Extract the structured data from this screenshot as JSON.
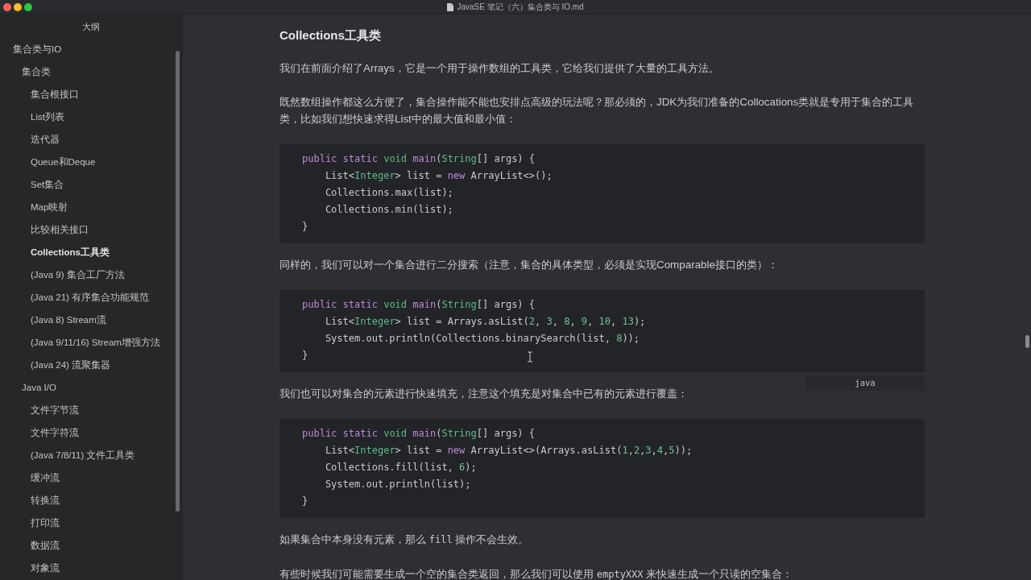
{
  "window": {
    "title": "JavaSE 笔记（六）集合类与 IO.md"
  },
  "sidebar": {
    "title": "大纲",
    "items": [
      {
        "label": "集合类与IO",
        "selected": false,
        "children": [
          {
            "label": "集合类",
            "selected": false,
            "children": [
              {
                "label": "集合根接口",
                "selected": false
              },
              {
                "label": "List列表",
                "selected": false
              },
              {
                "label": "迭代器",
                "selected": false
              },
              {
                "label": "Queue和Deque",
                "selected": false
              },
              {
                "label": "Set集合",
                "selected": false
              },
              {
                "label": "Map映射",
                "selected": false
              },
              {
                "label": "比较相关接口",
                "selected": false
              },
              {
                "label": "Collections工具类",
                "selected": true
              },
              {
                "label": "(Java 9) 集合工厂方法",
                "selected": false
              },
              {
                "label": "(Java 21) 有序集合功能规范",
                "selected": false
              },
              {
                "label": "(Java 8) Stream流",
                "selected": false
              },
              {
                "label": "(Java 9/11/16) Stream增强方法",
                "selected": false
              },
              {
                "label": "(Java 24) 流聚集器",
                "selected": false
              }
            ]
          },
          {
            "label": "Java I/O",
            "selected": false,
            "children": [
              {
                "label": "文件字节流",
                "selected": false
              },
              {
                "label": "文件字符流",
                "selected": false
              },
              {
                "label": "(Java 7/8/11) 文件工具类",
                "selected": false
              },
              {
                "label": "缓冲流",
                "selected": false
              },
              {
                "label": "转换流",
                "selected": false
              },
              {
                "label": "打印流",
                "selected": false
              },
              {
                "label": "数据流",
                "selected": false
              },
              {
                "label": "对象流",
                "selected": false
              }
            ]
          }
        ]
      }
    ]
  },
  "document": {
    "blocks": [
      {
        "kind": "heading",
        "text": "Collections工具类"
      },
      {
        "kind": "paragraph",
        "segments": [
          {
            "kind": "text",
            "text": "我们在前面介绍了Arrays，它是一个用于操作数组的工具类，它给我们提供了大量的工具方法。"
          }
        ]
      },
      {
        "kind": "paragraph",
        "segments": [
          {
            "kind": "text",
            "text": "既然数组操作都这么方便了，集合操作能不能也安排点高级的玩法呢？那必须的，JDK为我们准备的Collocations类就是专用于集合的工具类，比如我们想快速求得List中的最大值和最小值："
          }
        ]
      },
      {
        "kind": "code",
        "lines": [
          {
            "tokens": [
              {
                "kind": "keyword",
                "text": "public "
              },
              {
                "kind": "keyword",
                "text": "static "
              },
              {
                "kind": "type",
                "text": "void "
              },
              {
                "kind": "keyword",
                "text": "main"
              },
              {
                "kind": "plain",
                "text": "("
              },
              {
                "kind": "type",
                "text": "String"
              },
              {
                "kind": "plain",
                "text": "[] args) {"
              }
            ]
          },
          {
            "tokens": [
              {
                "kind": "plain",
                "text": "    List<"
              },
              {
                "kind": "type",
                "text": "Integer"
              },
              {
                "kind": "plain",
                "text": "> list = "
              },
              {
                "kind": "keyword",
                "text": "new"
              },
              {
                "kind": "plain",
                "text": " ArrayList<>();"
              }
            ]
          },
          {
            "tokens": [
              {
                "kind": "plain",
                "text": "    Collections.max(list);"
              }
            ]
          },
          {
            "tokens": [
              {
                "kind": "plain",
                "text": "    Collections.min(list);"
              }
            ]
          },
          {
            "tokens": [
              {
                "kind": "plain",
                "text": "}"
              }
            ]
          }
        ]
      },
      {
        "kind": "paragraph",
        "segments": [
          {
            "kind": "text",
            "text": "同样的，我们可以对一个集合进行二分搜索（注意，集合的具体类型，必须是实现Comparable接口的类）："
          }
        ]
      },
      {
        "kind": "code",
        "language": "java",
        "lines": [
          {
            "tokens": [
              {
                "kind": "keyword",
                "text": "public "
              },
              {
                "kind": "keyword",
                "text": "static "
              },
              {
                "kind": "type",
                "text": "void "
              },
              {
                "kind": "keyword",
                "text": "main"
              },
              {
                "kind": "plain",
                "text": "("
              },
              {
                "kind": "type",
                "text": "String"
              },
              {
                "kind": "plain",
                "text": "[] args) {"
              }
            ]
          },
          {
            "tokens": [
              {
                "kind": "plain",
                "text": "    List<"
              },
              {
                "kind": "type",
                "text": "Integer"
              },
              {
                "kind": "plain",
                "text": "> list = Arrays.asList("
              },
              {
                "kind": "number",
                "text": "2"
              },
              {
                "kind": "plain",
                "text": ", "
              },
              {
                "kind": "number",
                "text": "3"
              },
              {
                "kind": "plain",
                "text": ", "
              },
              {
                "kind": "number",
                "text": "8"
              },
              {
                "kind": "plain",
                "text": ", "
              },
              {
                "kind": "number",
                "text": "9"
              },
              {
                "kind": "plain",
                "text": ", "
              },
              {
                "kind": "number",
                "text": "10"
              },
              {
                "kind": "plain",
                "text": ", "
              },
              {
                "kind": "number",
                "text": "13"
              },
              {
                "kind": "plain",
                "text": ");"
              }
            ]
          },
          {
            "tokens": [
              {
                "kind": "plain",
                "text": "    System.out.println(Collections.binarySearch(list, "
              },
              {
                "kind": "number",
                "text": "8"
              },
              {
                "kind": "plain",
                "text": "));"
              }
            ]
          },
          {
            "tokens": [
              {
                "kind": "plain",
                "text": "}"
              }
            ]
          }
        ]
      },
      {
        "kind": "paragraph",
        "segments": [
          {
            "kind": "text",
            "text": "我们也可以对集合的元素进行快速填充，注意这个填充是对集合中已有的元素进行覆盖："
          }
        ]
      },
      {
        "kind": "code",
        "lines": [
          {
            "tokens": [
              {
                "kind": "keyword",
                "text": "public "
              },
              {
                "kind": "keyword",
                "text": "static "
              },
              {
                "kind": "type",
                "text": "void "
              },
              {
                "kind": "keyword",
                "text": "main"
              },
              {
                "kind": "plain",
                "text": "("
              },
              {
                "kind": "type",
                "text": "String"
              },
              {
                "kind": "plain",
                "text": "[] args) {"
              }
            ]
          },
          {
            "tokens": [
              {
                "kind": "plain",
                "text": "    List<"
              },
              {
                "kind": "type",
                "text": "Integer"
              },
              {
                "kind": "plain",
                "text": "> list = "
              },
              {
                "kind": "keyword",
                "text": "new"
              },
              {
                "kind": "plain",
                "text": " ArrayList<>(Arrays.asList("
              },
              {
                "kind": "number",
                "text": "1"
              },
              {
                "kind": "plain",
                "text": ","
              },
              {
                "kind": "number",
                "text": "2"
              },
              {
                "kind": "plain",
                "text": ","
              },
              {
                "kind": "number",
                "text": "3"
              },
              {
                "kind": "plain",
                "text": ","
              },
              {
                "kind": "number",
                "text": "4"
              },
              {
                "kind": "plain",
                "text": ","
              },
              {
                "kind": "number",
                "text": "5"
              },
              {
                "kind": "plain",
                "text": "));"
              }
            ]
          },
          {
            "tokens": [
              {
                "kind": "plain",
                "text": "    Collections.fill(list, "
              },
              {
                "kind": "number",
                "text": "6"
              },
              {
                "kind": "plain",
                "text": ");"
              }
            ]
          },
          {
            "tokens": [
              {
                "kind": "plain",
                "text": "    System.out.println(list);"
              }
            ]
          },
          {
            "tokens": [
              {
                "kind": "plain",
                "text": "}"
              }
            ]
          }
        ]
      },
      {
        "kind": "paragraph",
        "segments": [
          {
            "kind": "text",
            "text": "如果集合中本身没有元素，那么 "
          },
          {
            "kind": "code",
            "text": "fill"
          },
          {
            "kind": "text",
            "text": " 操作不会生效。"
          }
        ]
      },
      {
        "kind": "paragraph",
        "segments": [
          {
            "kind": "text",
            "text": "有些时候我们可能需要生成一个空的集合类返回，那么我们可以使用 "
          },
          {
            "kind": "code",
            "text": "emptyXXX"
          },
          {
            "kind": "text",
            "text": " 来快速生成一个只读的空集合："
          }
        ]
      }
    ]
  }
}
